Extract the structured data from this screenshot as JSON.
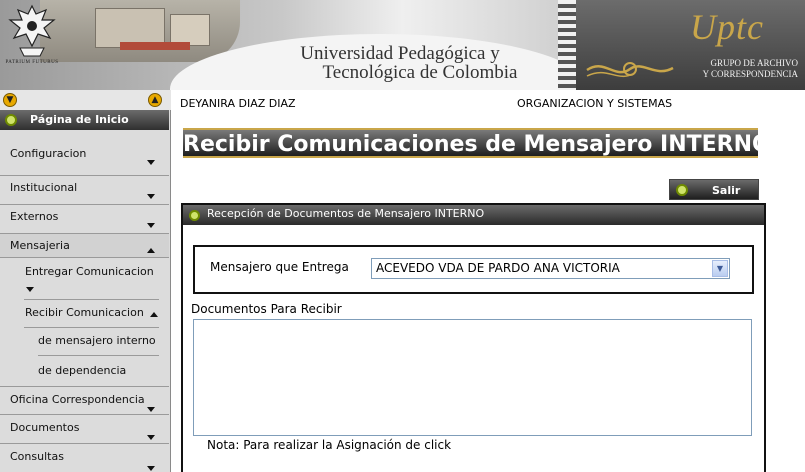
{
  "header": {
    "seal_caption": "PATRIUM FUTURUS",
    "university_line1": "Universidad Pedagógica y",
    "university_line2": "Tecnológica de Colombia",
    "logo_text": "Uptc",
    "group_line1": "GRUPO DE ARCHIVO",
    "group_line2": "Y CORRESPONDENCIA"
  },
  "sidebar": {
    "home_label": "Página de Inicio",
    "items": [
      {
        "label": "Configuracion",
        "state": "collapsed"
      },
      {
        "label": "Institucional",
        "state": "collapsed"
      },
      {
        "label": "Externos",
        "state": "collapsed"
      },
      {
        "label": "Mensajeria",
        "state": "expanded"
      }
    ],
    "mensajeria_sub": [
      {
        "label": "Entregar Comunicacion",
        "state": "collapsed"
      },
      {
        "label": "Recibir Comunicacion",
        "state": "expanded"
      }
    ],
    "recibir_sub": [
      {
        "label": "de mensajero interno"
      },
      {
        "label": "de dependencia"
      }
    ],
    "items_after": [
      {
        "label": "Oficina Correspondencia",
        "state": "collapsed"
      },
      {
        "label": "Documentos",
        "state": "collapsed"
      },
      {
        "label": "Consultas",
        "state": "collapsed"
      }
    ]
  },
  "user": {
    "name": "DEYANIRA DIAZ DIAZ",
    "department": "ORGANIZACION Y SISTEMAS"
  },
  "main": {
    "title": "Recibir Comunicaciones de Mensajero INTERNO",
    "exit_label": "Salir",
    "panel_title": "Recepción de Documentos de Mensajero INTERNO",
    "messenger_label": "Mensajero que Entrega",
    "messenger_selected": "ACEVEDO VDA DE PARDO ANA VICTORIA",
    "docs_label": "Documentos Para Recibir",
    "note": "Nota: Para realizar la Asignación de click"
  },
  "colors": {
    "gold_accent": "#c9a64a",
    "bar_dark": "#2f2f2f",
    "sidebar_bg": "#dcdcdc",
    "green_dot": "#cfe36a"
  }
}
